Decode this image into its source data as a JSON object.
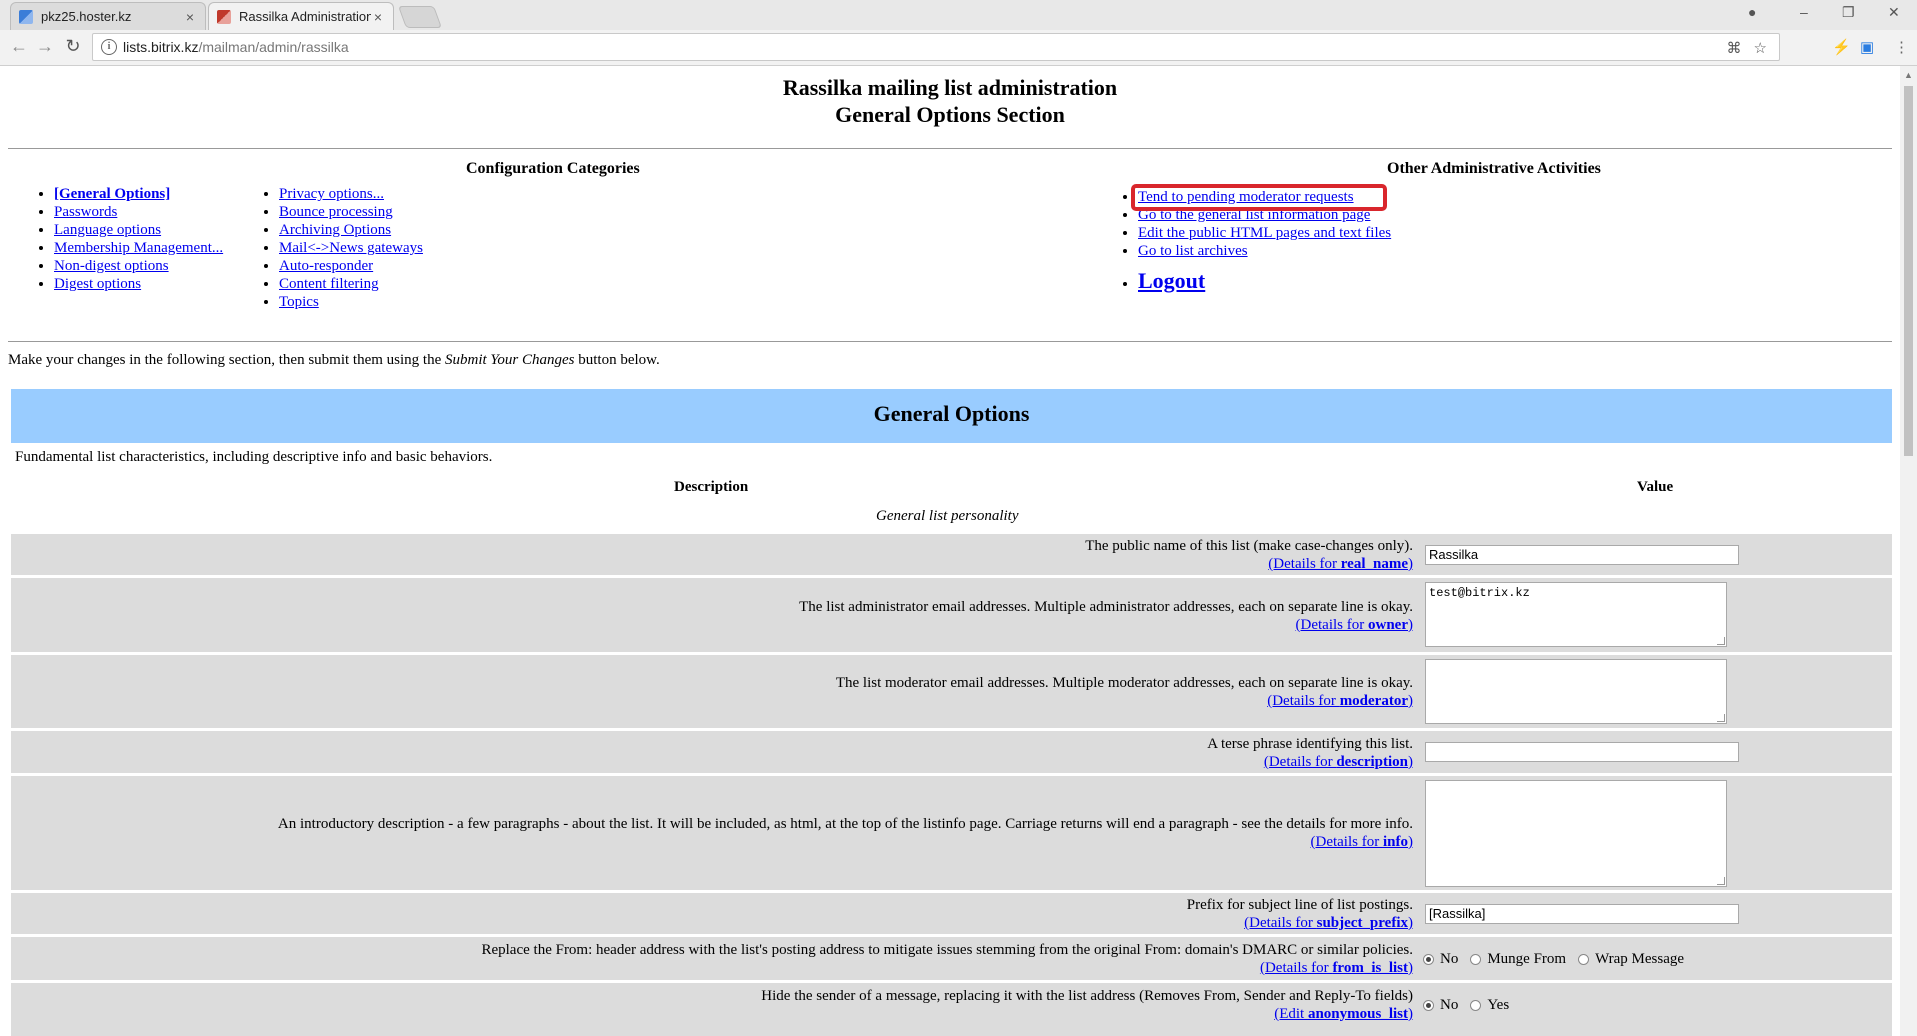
{
  "browser": {
    "tabs": [
      {
        "label": "pkz25.hoster.kz",
        "active": false
      },
      {
        "label": "Rassilka Administration (",
        "active": true
      }
    ],
    "address": {
      "host": "lists.bitrix.kz",
      "path": "/mailman/admin/rassilka"
    }
  },
  "header": {
    "title_line1": "Rassilka mailing list administration",
    "title_line2": "General Options Section"
  },
  "config": {
    "heading": "Configuration Categories",
    "col1": [
      "[General Options]",
      "Passwords",
      "Language options",
      "Membership Management...",
      "Non-digest options",
      "Digest options"
    ],
    "col2": [
      "Privacy options...",
      "Bounce processing",
      "Archiving Options",
      "Mail<->News gateways",
      "Auto-responder",
      "Content filtering",
      "Topics"
    ]
  },
  "admin": {
    "heading": "Other Administrative Activities",
    "links": [
      "Tend to pending moderator requests",
      "Go to the general list information page",
      "Edit the public HTML pages and text files",
      "Go to list archives"
    ],
    "logout": "Logout"
  },
  "intro": {
    "before": "Make your changes in the following section, then submit them using the ",
    "emph": "Submit Your Changes",
    "after": " button below."
  },
  "options": {
    "banner": "General Options",
    "subtitle": "Fundamental list characteristics, including descriptive info and basic behaviors.",
    "col_description": "Description",
    "col_value": "Value",
    "section": "General list personality",
    "rows": [
      {
        "text": "The public name of this list (make case-changes only).",
        "details_prefix": "(Details for ",
        "details_key": "real_name",
        "value": "Rassilka"
      },
      {
        "text": "The list administrator email addresses. Multiple administrator addresses, each on separate line is okay.",
        "details_prefix": "(Details for ",
        "details_key": "owner",
        "value": "test@bitrix.kz"
      },
      {
        "text": "The list moderator email addresses. Multiple moderator addresses, each on separate line is okay.",
        "details_prefix": "(Details for ",
        "details_key": "moderator",
        "value": ""
      },
      {
        "text": "A terse phrase identifying this list.",
        "details_prefix": "(Details for ",
        "details_key": "description",
        "value": ""
      },
      {
        "text": "An introductory description - a few paragraphs - about the list. It will be included, as html, at the top of the listinfo page. Carriage returns will end a paragraph - see the details for more info.",
        "details_prefix": "(Details for ",
        "details_key": "info",
        "value": ""
      },
      {
        "text": "Prefix for subject line of list postings.",
        "details_prefix": "(Details for ",
        "details_key": "subject_prefix",
        "value": "[Rassilka]"
      },
      {
        "text": "Replace the From: header address with the list's posting address to mitigate issues stemming from the original From: domain's DMARC or similar policies.",
        "details_prefix": "(Details for ",
        "details_key": "from_is_list",
        "options": [
          "No",
          "Munge From",
          "Wrap Message"
        ],
        "selected": "No"
      },
      {
        "text": "Hide the sender of a message, replacing it with the list address (Removes From, Sender and Reply-To fields)",
        "details_prefix": "(Edit ",
        "details_key": "anonymous_list",
        "options": [
          "No",
          "Yes"
        ],
        "selected": "No"
      }
    ]
  },
  "colors": {
    "banner": "#99ccff",
    "row": "#dcdcdc",
    "link": "#0000ee",
    "highlight": "#d9262c"
  }
}
